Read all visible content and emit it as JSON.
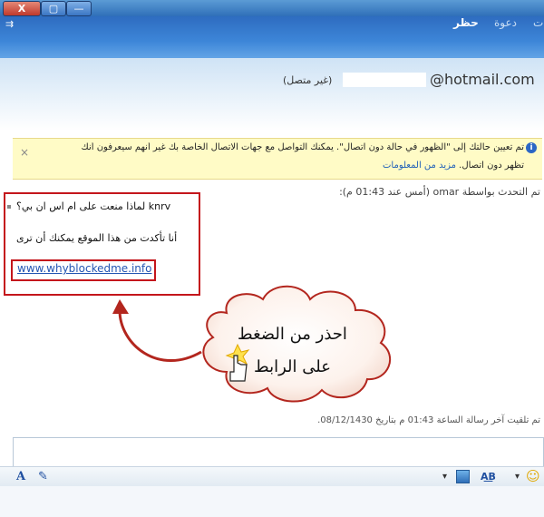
{
  "titlebar": {
    "close_glyph": "X",
    "maximize_glyph": "▢",
    "minimize_glyph": "—"
  },
  "toolbar": {
    "menu_glyph": "⇉",
    "items": [
      "حظر",
      "دعوة"
    ],
    "right_label": "ملفات"
  },
  "contact": {
    "email_suffix": "@hotmail.com",
    "status": "(غير متصل)"
  },
  "infobar": {
    "line1": "تم تعيين حالتك إلى \"الظهور في حالة دون اتصال\". يمكنك التواصل مع جهات الاتصال الخاصة بك غير أنهم سيعرفون أنك",
    "line2_text": "تظهر دون اتصال.",
    "line2_link": "مزيد من المعلومات",
    "close_glyph": "×",
    "icon_glyph": "i"
  },
  "conversation": {
    "talk_line": "تم التحدث بواسطة omar (أمس عند 01:43 م):",
    "messages": [
      "knrv لماذا منعت على ام اس ان بي؟",
      "أنا تأكدت من هذا الموقع يمكنك أن ترى"
    ],
    "link": "www.whyblockedme.info"
  },
  "callout": {
    "line1": "احذر من الضغط",
    "line2": "على الرابط"
  },
  "last_message": "تم تلقيت آخر رسالة الساعة 01:43 م بتاريخ 08/12/1430.",
  "bottom_toolbar": {
    "font_icon": "A",
    "ink_icon": "✎",
    "spell_label": "A͟B",
    "emoji_icon": "☺",
    "dropdown_glyph": "▾"
  },
  "colors": {
    "title_blue": "#2f6fb8",
    "highlight_red": "#c4161c",
    "info_yellow": "#fffbc6",
    "link_blue": "#2456b3"
  }
}
